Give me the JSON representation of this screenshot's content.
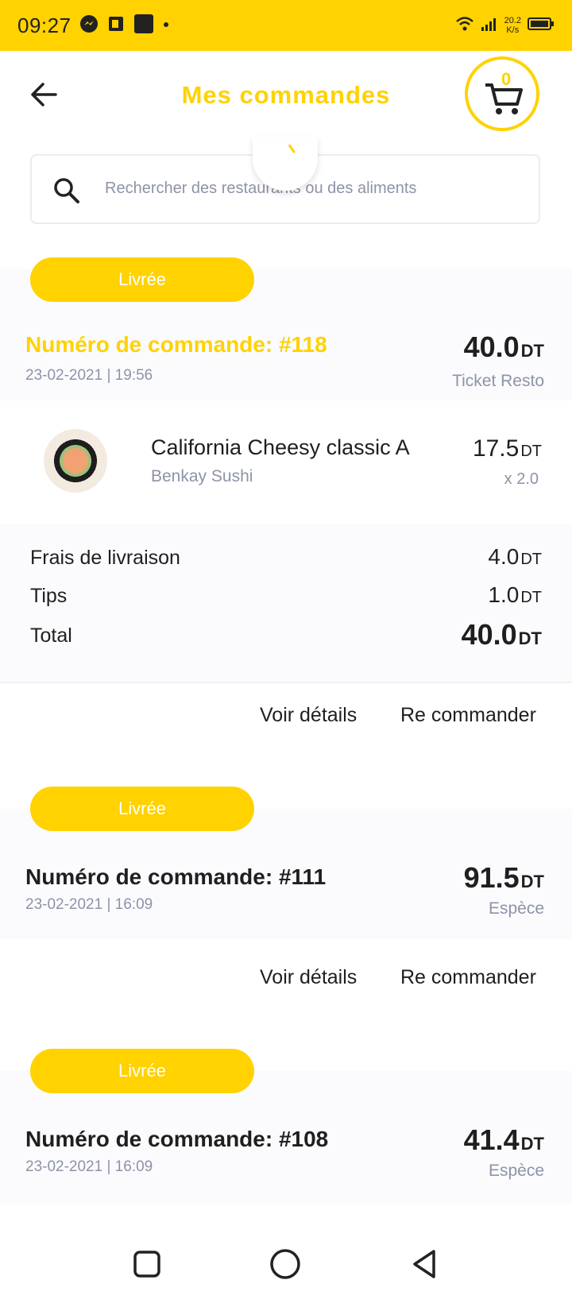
{
  "status_bar": {
    "time": "09:27",
    "speed_value": "20.2",
    "speed_unit": "K/s"
  },
  "header": {
    "title": "Mes commandes",
    "cart_count": "0"
  },
  "search": {
    "placeholder": "Rechercher des restaurants ou des aliments"
  },
  "currency": "DT",
  "orders": [
    {
      "status": "Livrée",
      "number": "Numéro de commande: #118",
      "date": "23-02-2021 | 19:56",
      "amount": "40.0",
      "payment": "Ticket Resto",
      "item": {
        "name": "California Cheesy classic A",
        "restaurant": "Benkay Sushi",
        "price": "17.5",
        "qty": "x 2.0"
      },
      "summary": {
        "delivery_label": "Frais de livraison",
        "delivery_value": "4.0",
        "tips_label": "Tips",
        "tips_value": "1.0",
        "total_label": "Total",
        "total_value": "40.0"
      },
      "actions": {
        "details": "Voir détails",
        "reorder": "Re commander"
      }
    },
    {
      "status": "Livrée",
      "number": "Numéro de commande: #111",
      "date": "23-02-2021 | 16:09",
      "amount": "91.5",
      "payment": "Espèce",
      "actions": {
        "details": "Voir détails",
        "reorder": "Re commander"
      }
    },
    {
      "status": "Livrée",
      "number": "Numéro de commande: #108",
      "date": "23-02-2021 | 16:09",
      "amount": "41.4",
      "payment": "Espèce"
    }
  ],
  "colors": {
    "accent": "#ffd200",
    "muted": "#8d93a8",
    "text": "#1f1f1f"
  },
  "icons": [
    "messenger-icon",
    "office-icon",
    "gallery-icon",
    "wifi-icon",
    "signal-icon",
    "battery-icon",
    "back-arrow-icon",
    "cart-icon",
    "search-icon",
    "square-nav-icon",
    "circle-nav-icon",
    "triangle-nav-icon"
  ]
}
